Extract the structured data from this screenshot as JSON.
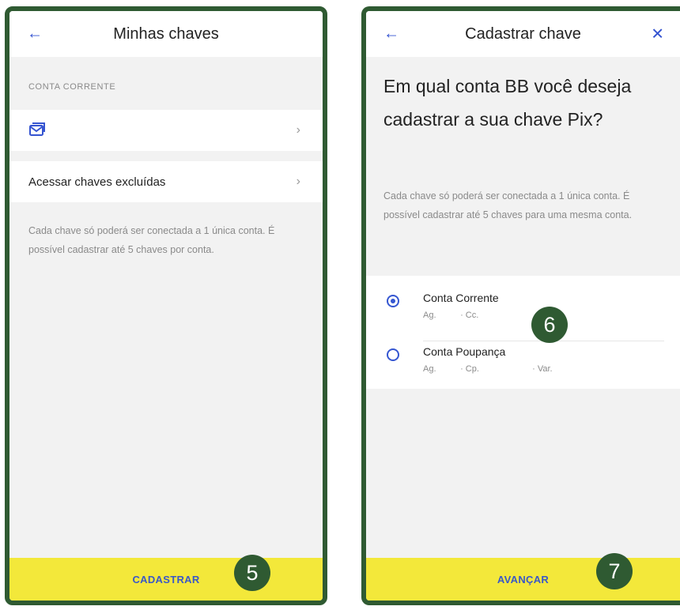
{
  "left_screen": {
    "title": "Minhas chaves",
    "section_label": "CONTA CORRENTE",
    "key_row_icon": "email-icon",
    "excluded_keys_label": "Acessar chaves excluídas",
    "info_text": "Cada chave só poderá ser conectada a 1 única conta. É possível cadastrar até 5 chaves por conta.",
    "primary_button": "CADASTRAR"
  },
  "right_screen": {
    "title": "Cadastrar chave",
    "headline": "Em qual conta BB você deseja cadastrar a sua chave Pix?",
    "info_text": "Cada chave só poderá ser conectada a 1 única conta. É possível cadastrar até 5 chaves para uma mesma conta.",
    "accounts": [
      {
        "name": "Conta Corrente",
        "detail": "Ag.          · Cc.",
        "selected": true
      },
      {
        "name": "Conta Poupança",
        "detail": "Ag.          · Cp.                      · Var.",
        "selected": false
      }
    ],
    "primary_button": "AVANÇAR"
  },
  "step_badges": [
    "5",
    "6",
    "7"
  ],
  "colors": {
    "accent_blue": "#3554d1",
    "button_yellow": "#f3e83a",
    "badge_green": "#2f5a32",
    "frame_green": "#2f5a32"
  }
}
